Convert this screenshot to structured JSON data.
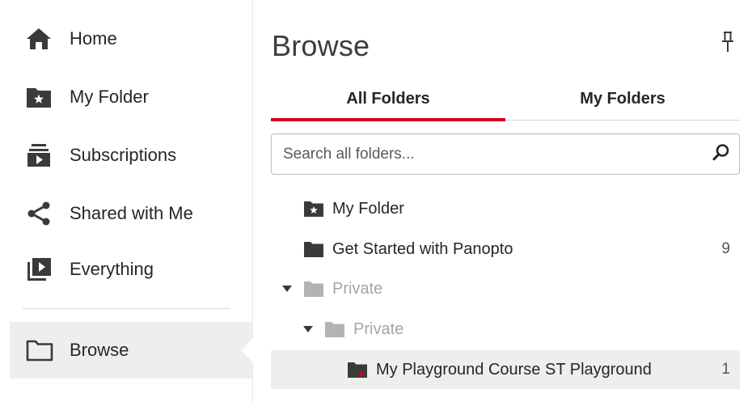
{
  "sidebar": {
    "items": [
      {
        "label": "Home",
        "icon": "home-icon"
      },
      {
        "label": "My Folder",
        "icon": "star-folder-icon"
      },
      {
        "label": "Subscriptions",
        "icon": "subscriptions-icon"
      },
      {
        "label": "Shared with Me",
        "icon": "share-icon"
      },
      {
        "label": "Everything",
        "icon": "video-library-icon"
      },
      {
        "label": "Browse",
        "icon": "folder-outline-icon",
        "active": true
      }
    ]
  },
  "browse": {
    "title": "Browse",
    "tabs": [
      {
        "label": "All Folders",
        "active": true
      },
      {
        "label": "My Folders",
        "active": false
      }
    ],
    "search": {
      "placeholder": "Search all folders...",
      "value": ""
    },
    "tree": [
      {
        "label": "My Folder",
        "count": "",
        "icon": "star-folder-icon",
        "state": "normal"
      },
      {
        "label": "Get Started with Panopto",
        "count": "9",
        "icon": "folder-icon",
        "state": "normal"
      },
      {
        "label": "Private",
        "count": "",
        "icon": "folder-icon",
        "state": "dim",
        "expanded": true
      },
      {
        "label": "Private",
        "count": "",
        "icon": "folder-icon",
        "state": "dim",
        "expanded": true
      },
      {
        "label": "My Playground Course ST Playground",
        "count": "1",
        "icon": "course-folder-icon",
        "state": "selected"
      }
    ]
  },
  "colors": {
    "accent": "#d0021b",
    "icon": "#3a3a3a",
    "dim_icon": "#b3b3b3",
    "selected_bg": "#eeeeee"
  }
}
